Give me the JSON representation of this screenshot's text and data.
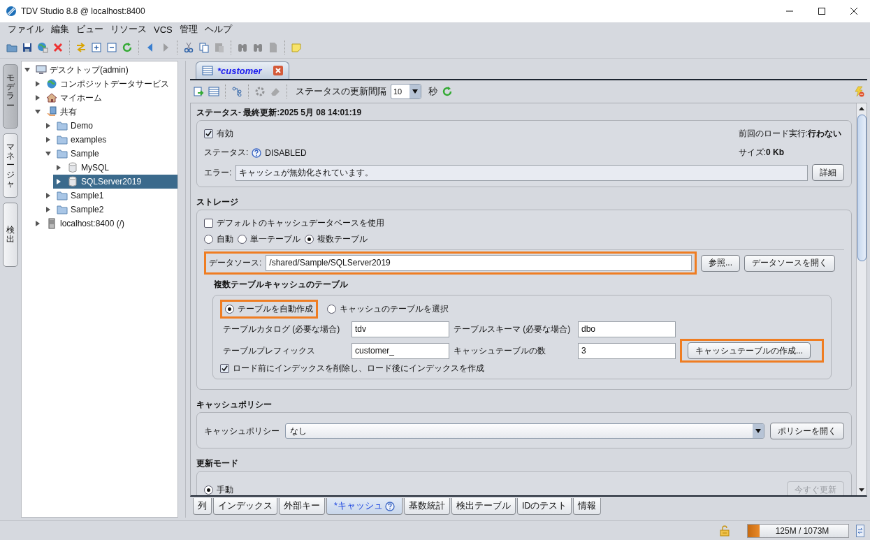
{
  "window": {
    "title": "TDV Studio 8.8 @ localhost:8400"
  },
  "menu": [
    {
      "label": "ファイル"
    },
    {
      "label": "編集"
    },
    {
      "label": "ビュー"
    },
    {
      "label": "リソース"
    },
    {
      "label": "VCS"
    },
    {
      "label": "管理"
    },
    {
      "label": "ヘルプ"
    }
  ],
  "toolbar": [
    {
      "kind": "open",
      "disabled": false
    },
    {
      "kind": "save",
      "disabled": false
    },
    {
      "kind": "globe",
      "disabled": false
    },
    {
      "kind": "delete",
      "disabled": false
    },
    {
      "kind": "separator"
    },
    {
      "kind": "swap",
      "disabled": false
    },
    {
      "kind": "add",
      "disabled": false
    },
    {
      "kind": "remove",
      "disabled": false
    },
    {
      "kind": "refresh",
      "disabled": false
    },
    {
      "kind": "separator"
    },
    {
      "kind": "back",
      "disabled": false
    },
    {
      "kind": "forward",
      "disabled": true
    },
    {
      "kind": "separator"
    },
    {
      "kind": "cut",
      "disabled": false
    },
    {
      "kind": "copy",
      "disabled": false
    },
    {
      "kind": "paste",
      "disabled": true
    },
    {
      "kind": "separator"
    },
    {
      "kind": "find",
      "disabled": true
    },
    {
      "kind": "find",
      "disabled": true
    },
    {
      "kind": "doc",
      "disabled": true
    },
    {
      "kind": "separator"
    },
    {
      "kind": "note",
      "disabled": false
    }
  ],
  "side_tabs": [
    {
      "label": "モデラー",
      "selected": true
    },
    {
      "label": "マネージャ",
      "selected": false
    },
    {
      "label": "検出",
      "selected": false
    }
  ],
  "tree": [
    {
      "label": "デスクトップ(admin)",
      "kind": "desktop",
      "expanded": true,
      "selected": false,
      "children": [
        {
          "label": "コンポジットデータサービス",
          "kind": "globe",
          "expanded": false,
          "selected": false
        },
        {
          "label": "マイホーム",
          "kind": "home",
          "expanded": false,
          "selected": false
        },
        {
          "label": "共有",
          "kind": "shared",
          "expanded": true,
          "selected": false,
          "children": [
            {
              "label": "Demo",
              "kind": "folder",
              "expanded": false,
              "selected": false
            },
            {
              "label": "examples",
              "kind": "folder",
              "expanded": false,
              "selected": false
            },
            {
              "label": "Sample",
              "kind": "folder",
              "expanded": true,
              "selected": false,
              "children": [
                {
                  "label": "MySQL",
                  "kind": "database",
                  "expanded": false,
                  "selected": false
                },
                {
                  "label": "SQLServer2019",
                  "kind": "database",
                  "expanded": false,
                  "selected": true
                }
              ]
            },
            {
              "label": "Sample1",
              "kind": "folder",
              "expanded": false,
              "selected": false
            },
            {
              "label": "Sample2",
              "kind": "folder",
              "expanded": false,
              "selected": false
            }
          ]
        },
        {
          "label": "localhost:8400 (/)",
          "kind": "server",
          "expanded": false,
          "selected": false
        }
      ]
    }
  ],
  "editor_tab": {
    "label": "*customer"
  },
  "editor_toolbar": {
    "icons": [
      {
        "kind": "export",
        "disabled": false
      },
      {
        "kind": "table",
        "disabled": false
      },
      {
        "kind": "separator"
      },
      {
        "kind": "nodes",
        "disabled": false
      },
      {
        "kind": "separator"
      },
      {
        "kind": "gear",
        "disabled": true
      },
      {
        "kind": "eraser",
        "disabled": true
      },
      {
        "kind": "separator"
      }
    ],
    "interval_label": "ステータスの更新間隔",
    "interval": "10",
    "unit": "秒"
  },
  "status": {
    "heading": "ステータス- 最終更新:2025 5月 08 14:01:19",
    "enabled": {
      "label": "有効",
      "checked": true
    },
    "last_load": "前回のロード実行:**行わない**",
    "status_label": "ステータス:",
    "status_value": "DISABLED",
    "size": "サイズ:**0 Kb**",
    "error_label": "エラー:",
    "error_value": "キャッシュが無効化されています。",
    "details_button": "詳細"
  },
  "storage": {
    "heading": "ストレージ",
    "use_default": {
      "label": "デフォルトのキャッシュデータベースを使用",
      "checked": false
    },
    "table_modes": [
      {
        "label": "自動",
        "selected": false
      },
      {
        "label": "単一テーブル",
        "selected": false
      },
      {
        "label": "複数テーブル",
        "selected": true
      }
    ],
    "data_source": {
      "label": "データソース:",
      "value": "/shared/Sample/SQLServer2019",
      "highlighted": true
    },
    "buttons": [
      {
        "label": "参照..."
      },
      {
        "label": "データソースを開く"
      }
    ],
    "multi_table": {
      "heading": "複数テーブルキャッシュのテーブル",
      "create_modes": [
        {
          "label": "テーブルを自動作成",
          "selected": true,
          "highlighted": true
        },
        {
          "label": "キャッシュのテーブルを選択",
          "selected": false,
          "highlighted": false
        }
      ],
      "fields": [
        {
          "label": "テーブルカタログ (必要な場合)",
          "value": "tdv"
        },
        {
          "label": "テーブルスキーマ (必要な場合)",
          "value": "dbo"
        },
        {
          "label": "テーブルプレフィックス",
          "value": "customer_"
        },
        {
          "label": "キャッシュテーブルの数",
          "value": "3"
        }
      ],
      "create_button": {
        "label": "キャッシュテーブルの作成...",
        "highlighted": true
      },
      "rebuild_indexes": {
        "label": "ロード前にインデックスを削除し、ロード後にインデックスを作成",
        "checked": true
      }
    }
  },
  "cache_policy": {
    "heading": "キャッシュポリシー",
    "label": "キャッシュポリシー",
    "value": "なし",
    "button": "ポリシーを開く"
  },
  "refresh_mode": {
    "heading": "更新モード",
    "modes": [
      {
        "label": "手動",
        "selected": true
      }
    ],
    "button": {
      "label": "今すぐ更新",
      "disabled": true
    }
  },
  "bottom_tabs": [
    {
      "label": "列",
      "selected": false,
      "help": false
    },
    {
      "label": "インデックス",
      "selected": false,
      "help": false
    },
    {
      "label": "外部キー",
      "selected": false,
      "help": false
    },
    {
      "label": "*キャッシュ",
      "selected": true,
      "help": true
    },
    {
      "label": "基数統計",
      "selected": false,
      "help": false
    },
    {
      "label": "検出テーブル",
      "selected": false,
      "help": false
    },
    {
      "label": "IDのテスト",
      "selected": false,
      "help": false
    },
    {
      "label": "情報",
      "selected": false,
      "help": false
    }
  ],
  "status_bar": {
    "memory": "125M / 1073M",
    "level": 0.117
  }
}
